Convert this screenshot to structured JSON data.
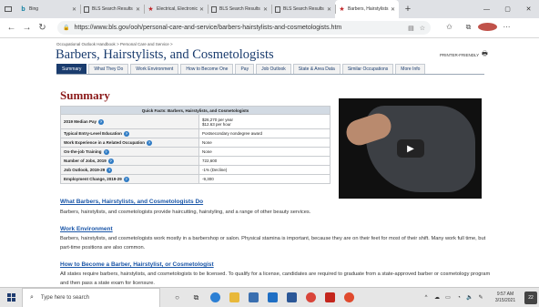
{
  "browser": {
    "tabs": [
      {
        "label": "Bing",
        "icon": "bing-icon",
        "active": false
      },
      {
        "label": "BLS Search Results",
        "icon": "document-icon",
        "active": false
      },
      {
        "label": "Electrical, Electronic",
        "icon": "bls-logo-icon",
        "active": false
      },
      {
        "label": "BLS Search Results",
        "icon": "document-icon",
        "active": false
      },
      {
        "label": "BLS Search Results",
        "icon": "document-icon",
        "active": false
      },
      {
        "label": "Barbers, Hairstylists",
        "icon": "bls-logo-icon",
        "active": true
      }
    ],
    "new_tab": "+",
    "window_controls": {
      "minimize": "—",
      "maximize": "▢",
      "close": "✕"
    },
    "url": "https://www.bls.gov/ooh/personal-care-and-service/barbers-hairstylists-and-cosmetologists.htm"
  },
  "page": {
    "breadcrumb": [
      "Occupational Outlook Handbook",
      "Personal Care and Service"
    ],
    "breadcrumb_sep": ">",
    "title": "Barbers, Hairstylists, and Cosmetologists",
    "printer_label": "PRINTER-FRIENDLY",
    "tabs": [
      "Summary",
      "What They Do",
      "Work Environment",
      "How to Become One",
      "Pay",
      "Job Outlook",
      "State & Area Data",
      "Similar Occupations",
      "More Info"
    ],
    "summary_heading": "Summary",
    "quick_facts": {
      "title": "Quick Facts: Barbers, Hairstylists, and Cosmetologists",
      "rows": [
        {
          "label": "2019 Median Pay",
          "value": "$26,270 per year",
          "value2": "$12.63 per hour"
        },
        {
          "label": "Typical Entry-Level Education",
          "value": "Postsecondary nondegree award"
        },
        {
          "label": "Work Experience in a Related Occupation",
          "value": "None"
        },
        {
          "label": "On-the-job Training",
          "value": "None"
        },
        {
          "label": "Number of Jobs, 2019",
          "value": "722,600"
        },
        {
          "label": "Job Outlook, 2019-29",
          "value": "-1% (Decline)"
        },
        {
          "label": "Employment Change, 2019-29",
          "value": "-9,300"
        }
      ]
    },
    "sections": [
      {
        "heading": "What Barbers, Hairstylists, and Cosmetologists Do",
        "text": "Barbers, hairstylists, and cosmetologists provide haircutting, hairstyling, and a range of other beauty services."
      },
      {
        "heading": "Work Environment",
        "text": "Barbers, hairstylists, and cosmetologists work mostly in a barbershop or salon. Physical stamina is important, because they are on their feet for most of their shift. Many work full time, but part-time positions are also common."
      },
      {
        "heading": "How to Become a Barber, Hairstylist, or Cosmetologist",
        "text": "All states require barbers, hairstylists, and cosmetologists to be licensed. To qualify for a license, candidates are required to graduate from a state-approved barber or cosmetology program and then pass a state exam for licensure."
      }
    ]
  },
  "taskbar": {
    "search_placeholder": "Type here to search",
    "time": "9:57 AM",
    "date": "3/15/2021",
    "notification_count": "22"
  }
}
